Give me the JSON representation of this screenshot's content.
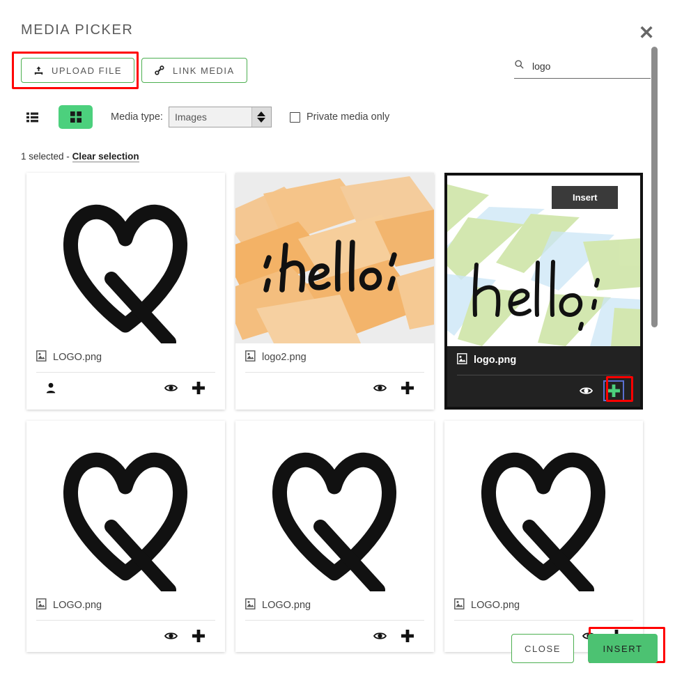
{
  "dialog": {
    "title": "MEDIA PICKER",
    "close_icon": "close-icon"
  },
  "actions": {
    "upload_label": "UPLOAD FILE",
    "upload_icon": "upload-icon",
    "link_label": "LINK MEDIA",
    "link_icon": "link-icon"
  },
  "search": {
    "value": "logo",
    "placeholder": "Search",
    "icon": "search-icon"
  },
  "filters": {
    "view_list_icon": "list-view-icon",
    "view_grid_icon": "grid-view-icon",
    "media_type_label": "Media type:",
    "media_type_value": "Images",
    "media_type_options": [
      "Images"
    ],
    "private_label": "Private media only",
    "private_checked": false
  },
  "selection": {
    "count_text": "1 selected -",
    "clear_label": "Clear selection"
  },
  "tooltip": {
    "insert_label": "Insert"
  },
  "cards": [
    {
      "name": "LOGO.png",
      "thumb": "heart-q-logo",
      "selected": false,
      "has_user_icon": true,
      "preview_icon": "eye-icon",
      "insert_icon": "plus-icon"
    },
    {
      "name": "logo2.png",
      "thumb": "hello-orange",
      "selected": false,
      "has_user_icon": false,
      "preview_icon": "eye-icon",
      "insert_icon": "plus-icon"
    },
    {
      "name": "logo.png",
      "thumb": "hello-green-blue",
      "selected": true,
      "has_user_icon": false,
      "preview_icon": "eye-icon",
      "insert_icon": "plus-icon"
    },
    {
      "name": "LOGO.png",
      "thumb": "heart-q-logo",
      "selected": false,
      "has_user_icon": false,
      "preview_icon": "eye-icon",
      "insert_icon": "plus-icon"
    },
    {
      "name": "LOGO.png",
      "thumb": "heart-q-logo",
      "selected": false,
      "has_user_icon": false,
      "preview_icon": "eye-icon",
      "insert_icon": "plus-icon"
    },
    {
      "name": "LOGO.png",
      "thumb": "heart-q-logo",
      "selected": false,
      "has_user_icon": false,
      "preview_icon": "eye-icon",
      "insert_icon": "plus-icon"
    }
  ],
  "footer": {
    "close_label": "CLOSE",
    "insert_label": "INSERT"
  },
  "colors": {
    "accent_green": "#4cc272",
    "outline_green": "#4caf50",
    "highlight_red": "#ff0000",
    "selected_bg": "#222222"
  }
}
